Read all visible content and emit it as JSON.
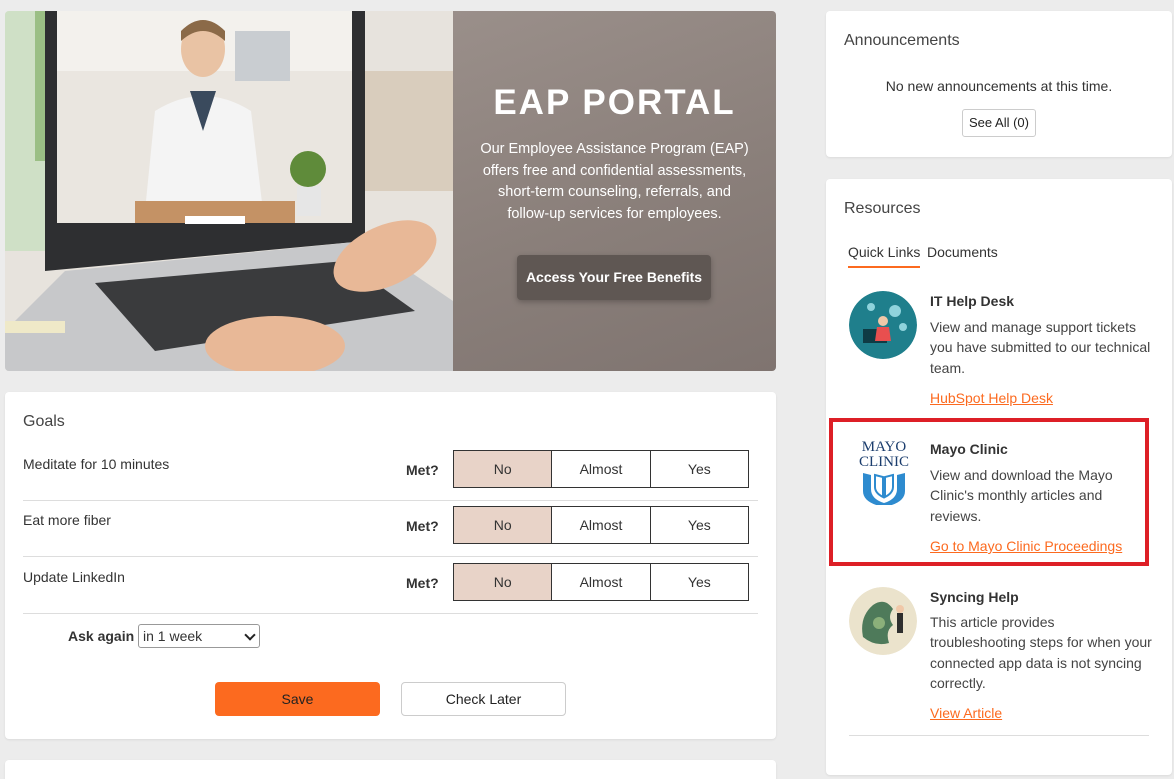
{
  "hero": {
    "title": "EAP PORTAL",
    "description": "Our Employee Assistance Program (EAP) offers free and confidential assessments, short-term counseling, referrals, and follow-up services for employees.",
    "button": "Access Your Free Benefits"
  },
  "goals": {
    "title": "Goals",
    "met_label": "Met?",
    "options": [
      "No",
      "Almost",
      "Yes"
    ],
    "selected_option": "No",
    "items": [
      {
        "name": "Meditate for 10 minutes"
      },
      {
        "name": "Eat more fiber"
      },
      {
        "name": "Update LinkedIn"
      }
    ],
    "ask_again_label": "Ask again",
    "ask_again_value": "in 1 week",
    "save_label": "Save",
    "check_later_label": "Check Later"
  },
  "announcements": {
    "title": "Announcements",
    "empty_text": "No new announcements at this time.",
    "see_all_label": "See All (0)"
  },
  "resources": {
    "title": "Resources",
    "tabs": [
      {
        "label": "Quick Links",
        "active": true
      },
      {
        "label": "Documents",
        "active": false
      }
    ],
    "items": [
      {
        "title": "IT Help Desk",
        "description": "View and manage support tickets you have submitted to our technical team.",
        "link": "HubSpot Help Desk",
        "icon": "it-help-desk-illustration"
      },
      {
        "title": "Mayo Clinic",
        "description": "View and download the Mayo Clinic's monthly articles and reviews.",
        "link": "Go to Mayo Clinic Proceedings",
        "icon": "mayo-clinic-logo",
        "logo_text": [
          "MAYO",
          "CLINIC"
        ]
      },
      {
        "title": "Syncing Help",
        "description": "This article provides troubleshooting steps for when your connected app data is not syncing correctly.",
        "link": "View Article",
        "icon": "syncing-help-illustration"
      }
    ]
  },
  "colors": {
    "accent": "#fc6a1f",
    "selected_option_bg": "#e8d3c8",
    "highlight_border": "#dd1f26",
    "hero_panel": "#8a7f7a",
    "page_bg": "#ececec"
  }
}
